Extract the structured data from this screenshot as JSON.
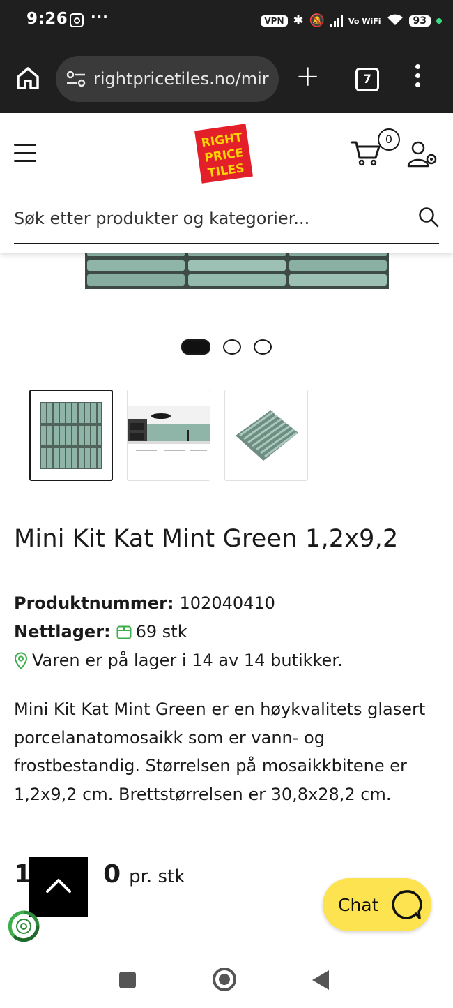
{
  "status_bar": {
    "time": "9:26",
    "vpn": "VPN",
    "vowifi": "Vo WiFi",
    "battery": "93",
    "more": "···"
  },
  "browser": {
    "url": "rightpricetiles.no/mir",
    "tab_count": "7",
    "new_tab": "+"
  },
  "header": {
    "logo_text": [
      "RIGHT",
      "PRICE",
      "TILES"
    ],
    "cart_count": "0",
    "search_placeholder": "Søk etter produkter og kategorier..."
  },
  "gallery": {
    "slide_count": 3,
    "active_slide": 1,
    "thumbnails": [
      {
        "name": "thumbnail-mosaic-sheet",
        "selected": true
      },
      {
        "name": "thumbnail-kitchen-scene",
        "selected": false
      },
      {
        "name": "thumbnail-angled-sheet",
        "selected": false
      }
    ]
  },
  "product": {
    "title": "Mini Kit Kat Mint Green 1,2x9,2",
    "product_number_label": "Produktnummer:",
    "product_number": "102040410",
    "stock_label": "Nettlager:",
    "stock_value": "69 stk",
    "store_availability": "Varen er på lager i 14 av 14 butikker.",
    "description": "Mini Kit Kat Mint Green er en høykvalitets glasert porcelanatomosaikk som er vann- og frostbestandig. Størrelsen på mosaikkbitene er 1,2x9,2 cm. Brettstørrelsen er 30,8x28,2 cm.",
    "price_visible_start": "15",
    "price_visible_end": "0",
    "price_unit": "pr. stk"
  },
  "chat": {
    "label": "Chat"
  },
  "colors": {
    "chat_yellow": "#fde34f",
    "logo_red": "#e3202a",
    "logo_yellow": "#ffd400",
    "tile_green": "#8fb5a8",
    "stock_green": "#3cae4a"
  }
}
